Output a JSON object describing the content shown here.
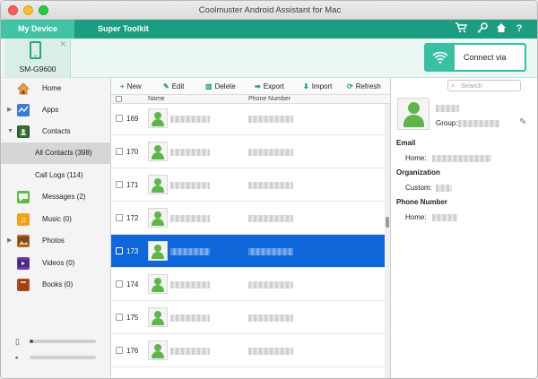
{
  "window": {
    "title": "Coolmuster Android Assistant for Mac"
  },
  "menubar": {
    "tabs": [
      {
        "label": "My Device"
      },
      {
        "label": "Super Toolkit"
      }
    ],
    "icons": [
      "cart-icon",
      "key-icon",
      "home-icon",
      "help-icon"
    ],
    "help_label": "?"
  },
  "device": {
    "name": "SM-G9600",
    "connect_label": "Connect via WIFI"
  },
  "sidebar": {
    "home": "Home",
    "apps": "Apps",
    "contacts": "Contacts",
    "all_contacts": "All Contacts (398)",
    "call_logs": "Call Logs (114)",
    "messages": "Messages (2)",
    "music": "Music (0)",
    "photos": "Photos",
    "videos": "Videos (0)",
    "books": "Books (0)",
    "storage_internal_used": 0.05,
    "storage_sd_used": 0.0
  },
  "toolbar": {
    "new": "New",
    "edit": "Edit",
    "delete": "Delete",
    "export": "Export",
    "import": "Import",
    "refresh": "Refresh"
  },
  "search": {
    "placeholder": "Search"
  },
  "table": {
    "columns": [
      "Name",
      "Phone Number"
    ],
    "rows": [
      {
        "num": "169",
        "selected": false
      },
      {
        "num": "170",
        "selected": false
      },
      {
        "num": "171",
        "selected": false
      },
      {
        "num": "172",
        "selected": false
      },
      {
        "num": "173",
        "selected": true
      },
      {
        "num": "174",
        "selected": false
      },
      {
        "num": "175",
        "selected": false
      },
      {
        "num": "176",
        "selected": false
      }
    ]
  },
  "detail": {
    "group_label": "Group:",
    "email_header": "Email",
    "email_home_label": "Home:",
    "org_header": "Organization",
    "org_custom_label": "Custom:",
    "phone_header": "Phone Number",
    "phone_home_label": "Home:"
  },
  "colors": {
    "accent": "#1c9d82",
    "tab_active": "#42c3a6",
    "selection": "#0f67da"
  }
}
